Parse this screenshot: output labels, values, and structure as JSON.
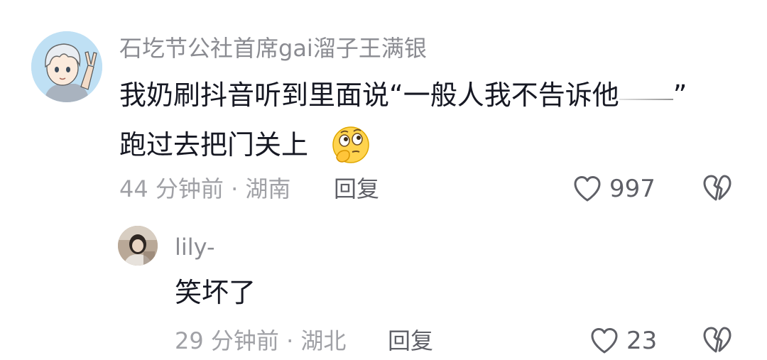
{
  "comments": [
    {
      "avatar": "cartoon-boy-peace-sign-avatar",
      "username": "石圪节公社首席gai溜子王满银",
      "text_line1_before": "我奶刷抖音听到里面说“一般人我不告诉他",
      "text_line1_after": "”",
      "text_line2": "跑过去把门关上",
      "emoji": "thinking-face-emoji",
      "time": "44 分钟前",
      "separator": "·",
      "location": "湖南",
      "reply_label": "回复",
      "like_count": "997"
    }
  ],
  "replies": [
    {
      "avatar": "photo-avatar",
      "username": "lily-",
      "text": "笑坏了",
      "time": "29 分钟前",
      "separator": "·",
      "location": "湖北",
      "reply_label": "回复",
      "like_count": "23"
    }
  ],
  "colors": {
    "username": "#8a8b91",
    "content": "#161823",
    "meta": "#a0a1a6",
    "action": "#5f6067"
  },
  "icons": [
    "heart-outline-icon",
    "broken-heart-icon"
  ]
}
